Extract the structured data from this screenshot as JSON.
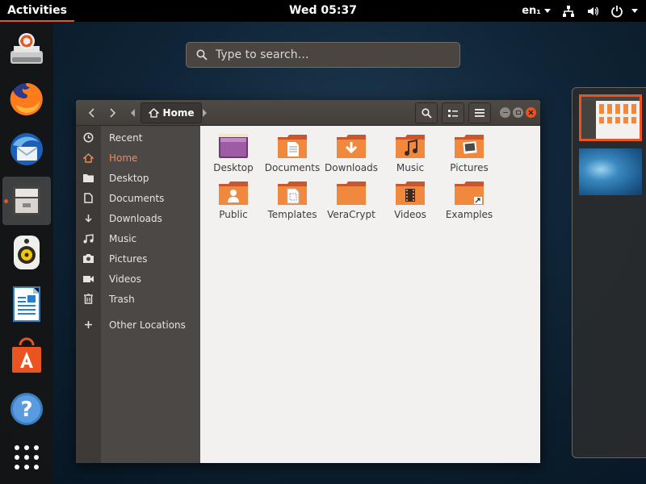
{
  "topbar": {
    "activities": "Activities",
    "clock": "Wed 05:37",
    "lang": "en₁"
  },
  "search": {
    "placeholder": "Type to search…"
  },
  "dock": {
    "items": [
      {
        "name": "usb-creator-icon"
      },
      {
        "name": "firefox-icon"
      },
      {
        "name": "thunderbird-icon"
      },
      {
        "name": "files-icon"
      },
      {
        "name": "rhythmbox-icon"
      },
      {
        "name": "libreoffice-writer-icon"
      },
      {
        "name": "software-center-icon"
      },
      {
        "name": "help-icon"
      },
      {
        "name": "show-applications-icon"
      }
    ]
  },
  "window": {
    "path": "Home",
    "sidebar": [
      {
        "label": "Recent",
        "icon": "clock-icon"
      },
      {
        "label": "Home",
        "icon": "home-icon",
        "selected": true
      },
      {
        "label": "Desktop",
        "icon": "folder-icon"
      },
      {
        "label": "Documents",
        "icon": "document-icon"
      },
      {
        "label": "Downloads",
        "icon": "download-icon"
      },
      {
        "label": "Music",
        "icon": "music-icon"
      },
      {
        "label": "Pictures",
        "icon": "camera-icon"
      },
      {
        "label": "Videos",
        "icon": "video-icon"
      },
      {
        "label": "Trash",
        "icon": "trash-icon"
      },
      {
        "label": "Other Locations",
        "icon": "plus-icon"
      }
    ],
    "files": [
      {
        "label": "Desktop",
        "type": "desktop"
      },
      {
        "label": "Documents",
        "type": "documents"
      },
      {
        "label": "Downloads",
        "type": "downloads"
      },
      {
        "label": "Music",
        "type": "music"
      },
      {
        "label": "Pictures",
        "type": "pictures"
      },
      {
        "label": "Public",
        "type": "public"
      },
      {
        "label": "Templates",
        "type": "templates"
      },
      {
        "label": "VeraCrypt",
        "type": "folder"
      },
      {
        "label": "Videos",
        "type": "videos"
      },
      {
        "label": "Examples",
        "type": "examples"
      }
    ]
  },
  "colors": {
    "accent": "#e95420",
    "folder": "#f0883e",
    "panel": "#000000"
  }
}
